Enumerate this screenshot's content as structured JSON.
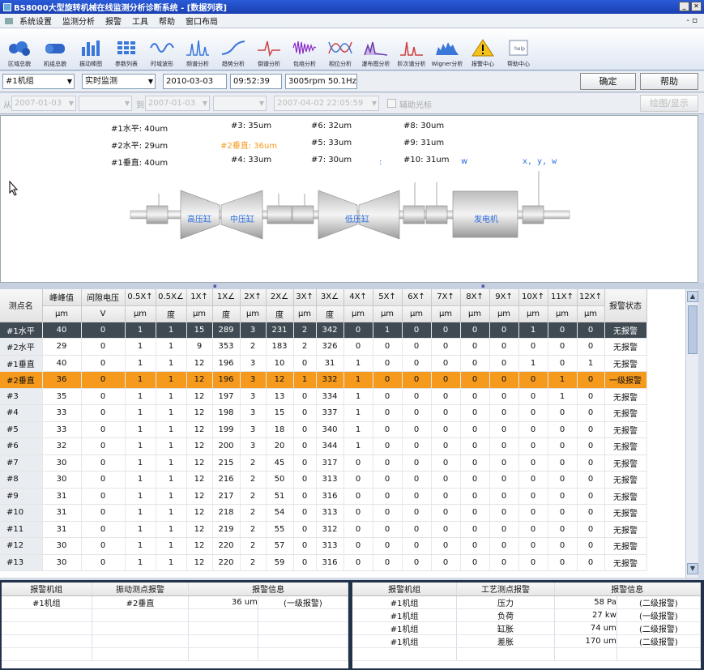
{
  "window": {
    "title": "BS8000大型旋转机械在线监测分析诊断系统 - [数据列表]"
  },
  "menu": [
    "系统设置",
    "监测分析",
    "报警",
    "工具",
    "帮助",
    "窗口布局"
  ],
  "toolbar": [
    {
      "label": "区域总貌",
      "icon": "area-overview-icon"
    },
    {
      "label": "机组总貌",
      "icon": "unit-overview-icon"
    },
    {
      "label": "振动棒图",
      "icon": "bar-graph-icon"
    },
    {
      "label": "参数列表",
      "icon": "list-icon"
    },
    {
      "label": "时域波形",
      "icon": "waveform-icon"
    },
    {
      "label": "频谱分析",
      "icon": "spectrum-icon"
    },
    {
      "label": "趋势分析",
      "icon": "trend-icon"
    },
    {
      "label": "倒谱分析",
      "icon": "cepstrum-icon"
    },
    {
      "label": "包络分析",
      "icon": "envelope-icon"
    },
    {
      "label": "相位分析",
      "icon": "phase-icon"
    },
    {
      "label": "瀑布图分析",
      "icon": "waterfall-icon"
    },
    {
      "label": "阶次谱分析",
      "icon": "order-icon"
    },
    {
      "label": "Wigner分析",
      "icon": "wigner-icon"
    },
    {
      "label": "报警中心",
      "icon": "warning-icon"
    },
    {
      "label": "帮助中心",
      "icon": "help-icon"
    }
  ],
  "controls": {
    "unit": "#1机组",
    "mode": "实时监测",
    "date": "2010-03-03",
    "time": "09:52:39",
    "speed": "3005rpm 50.1Hz",
    "confirm": "确定",
    "help": "帮助"
  },
  "filter": {
    "from_label": "从",
    "from_date": "2007-01-03",
    "to_label": "到",
    "to_date": "2007-01-03",
    "range": "2007-04-02 22:05:59",
    "checkbox_label": "辅助光标",
    "draw_label": "绘图/显示"
  },
  "diagram": {
    "points": [
      {
        "text": "#1水平: 40um",
        "hl": false
      },
      {
        "text": "#2水平: 29um",
        "hl": false
      },
      {
        "text": "#1垂直: 40um",
        "hl": false
      },
      {
        "text": "#3: 35um",
        "hl": false
      },
      {
        "text": "#2垂直: 36um",
        "hl": true
      },
      {
        "text": "#4: 33um",
        "hl": false
      },
      {
        "text": "#6: 32um",
        "hl": false
      },
      {
        "text": "#5: 33um",
        "hl": false
      },
      {
        "text": "#7: 30um",
        "hl": false
      },
      {
        "text": "#8: 30um",
        "hl": false
      },
      {
        "text": "#9: 31um",
        "hl": false
      },
      {
        "text": "#10: 31um",
        "hl": false
      }
    ],
    "marks": {
      "w": "w",
      "xyw": "x, y, w",
      "colon": ":"
    },
    "labels": {
      "hp": "高压缸",
      "ip": "中压缸",
      "lp": "低压缸",
      "gen": "发电机"
    }
  },
  "grid": {
    "headers": [
      "测点名",
      "峰峰值",
      "间隙电压",
      "0.5X↑",
      "0.5X∠",
      "1X↑",
      "1X∠",
      "2X↑",
      "2X∠",
      "3X↑",
      "3X∠",
      "4X↑",
      "5X↑",
      "6X↑",
      "7X↑",
      "8X↑",
      "9X↑",
      "10X↑",
      "11X↑",
      "12X↑",
      "报警状态"
    ],
    "units": [
      "",
      "μm",
      "V",
      "μm",
      "度",
      "μm",
      "度",
      "μm",
      "度",
      "μm",
      "度",
      "μm",
      "μm",
      "μm",
      "μm",
      "μm",
      "μm",
      "μm",
      "μm",
      "μm",
      ""
    ],
    "rows": [
      [
        "#1水平",
        "40",
        "0",
        "1",
        "1",
        "15",
        "289",
        "3",
        "231",
        "2",
        "342",
        "0",
        "1",
        "0",
        "0",
        "0",
        "0",
        "1",
        "0",
        "0",
        "无报警"
      ],
      [
        "#2水平",
        "29",
        "0",
        "1",
        "1",
        "9",
        "353",
        "2",
        "183",
        "2",
        "326",
        "0",
        "0",
        "0",
        "0",
        "0",
        "0",
        "0",
        "0",
        "0",
        "无报警"
      ],
      [
        "#1垂直",
        "40",
        "0",
        "1",
        "1",
        "12",
        "196",
        "3",
        "10",
        "0",
        "31",
        "1",
        "0",
        "0",
        "0",
        "0",
        "0",
        "1",
        "0",
        "1",
        "无报警"
      ],
      [
        "#2垂直",
        "36",
        "0",
        "1",
        "1",
        "12",
        "196",
        "3",
        "12",
        "1",
        "332",
        "1",
        "0",
        "0",
        "0",
        "0",
        "0",
        "0",
        "1",
        "0",
        "一级报警"
      ],
      [
        "#3",
        "35",
        "0",
        "1",
        "1",
        "12",
        "197",
        "3",
        "13",
        "0",
        "334",
        "1",
        "0",
        "0",
        "0",
        "0",
        "0",
        "0",
        "1",
        "0",
        "无报警"
      ],
      [
        "#4",
        "33",
        "0",
        "1",
        "1",
        "12",
        "198",
        "3",
        "15",
        "0",
        "337",
        "1",
        "0",
        "0",
        "0",
        "0",
        "0",
        "0",
        "0",
        "0",
        "无报警"
      ],
      [
        "#5",
        "33",
        "0",
        "1",
        "1",
        "12",
        "199",
        "3",
        "18",
        "0",
        "340",
        "1",
        "0",
        "0",
        "0",
        "0",
        "0",
        "0",
        "0",
        "0",
        "无报警"
      ],
      [
        "#6",
        "32",
        "0",
        "1",
        "1",
        "12",
        "200",
        "3",
        "20",
        "0",
        "344",
        "1",
        "0",
        "0",
        "0",
        "0",
        "0",
        "0",
        "0",
        "0",
        "无报警"
      ],
      [
        "#7",
        "30",
        "0",
        "1",
        "1",
        "12",
        "215",
        "2",
        "45",
        "0",
        "317",
        "0",
        "0",
        "0",
        "0",
        "0",
        "0",
        "0",
        "0",
        "0",
        "无报警"
      ],
      [
        "#8",
        "30",
        "0",
        "1",
        "1",
        "12",
        "216",
        "2",
        "50",
        "0",
        "313",
        "0",
        "0",
        "0",
        "0",
        "0",
        "0",
        "0",
        "0",
        "0",
        "无报警"
      ],
      [
        "#9",
        "31",
        "0",
        "1",
        "1",
        "12",
        "217",
        "2",
        "51",
        "0",
        "316",
        "0",
        "0",
        "0",
        "0",
        "0",
        "0",
        "0",
        "0",
        "0",
        "无报警"
      ],
      [
        "#10",
        "31",
        "0",
        "1",
        "1",
        "12",
        "218",
        "2",
        "54",
        "0",
        "313",
        "0",
        "0",
        "0",
        "0",
        "0",
        "0",
        "0",
        "0",
        "0",
        "无报警"
      ],
      [
        "#11",
        "31",
        "0",
        "1",
        "1",
        "12",
        "219",
        "2",
        "55",
        "0",
        "312",
        "0",
        "0",
        "0",
        "0",
        "0",
        "0",
        "0",
        "0",
        "0",
        "无报警"
      ],
      [
        "#12",
        "30",
        "0",
        "1",
        "1",
        "12",
        "220",
        "2",
        "57",
        "0",
        "313",
        "0",
        "0",
        "0",
        "0",
        "0",
        "0",
        "0",
        "0",
        "0",
        "无报警"
      ],
      [
        "#13",
        "30",
        "0",
        "1",
        "1",
        "12",
        "220",
        "2",
        "59",
        "0",
        "316",
        "0",
        "0",
        "0",
        "0",
        "0",
        "0",
        "0",
        "0",
        "0",
        "无报警"
      ]
    ]
  },
  "alarm_left": {
    "headers": [
      "报警机组",
      "振动测点报警",
      "报警信息"
    ],
    "rows": [
      [
        "#1机组",
        "#2垂直",
        "36 um",
        "(一级报警)"
      ]
    ]
  },
  "alarm_right": {
    "headers": [
      "报警机组",
      "工艺测点报警",
      "报警信息"
    ],
    "rows": [
      [
        "#1机组",
        "压力",
        "58 Pa",
        "(二级报警)"
      ],
      [
        "#1机组",
        "负荷",
        "27 kw",
        "(一级报警)"
      ],
      [
        "#1机组",
        "缸胀",
        "74 um",
        "(二级报警)"
      ],
      [
        "#1机组",
        "差胀",
        "170 um",
        "(二级报警)"
      ]
    ]
  },
  "colors": {
    "accent": "#f59a1c",
    "selected": "#3f4a52",
    "title": "#1a3fb0"
  }
}
